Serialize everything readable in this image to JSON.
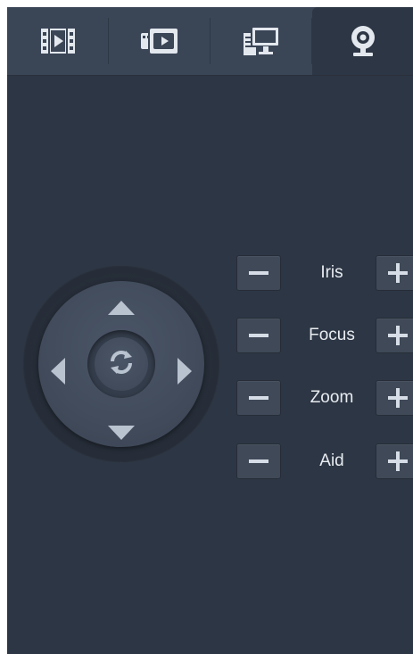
{
  "tabs": [
    {
      "icon": "film-icon",
      "active": false
    },
    {
      "icon": "video-device-icon",
      "active": false
    },
    {
      "icon": "monitor-device-icon",
      "active": false
    },
    {
      "icon": "webcam-icon",
      "active": true
    }
  ],
  "ptz": {
    "center_icon": "refresh-icon",
    "arrows": [
      "up",
      "down",
      "left",
      "right"
    ]
  },
  "controls": [
    {
      "label": "Iris"
    },
    {
      "label": "Focus"
    },
    {
      "label": "Zoom"
    },
    {
      "label": "Aid"
    }
  ],
  "colors": {
    "panel_bg": "#2d3644",
    "tabbar_bg": "#3a4556",
    "button_bg": "#3f4958",
    "text": "#e8ecf1",
    "icon": "#d6dde6"
  }
}
